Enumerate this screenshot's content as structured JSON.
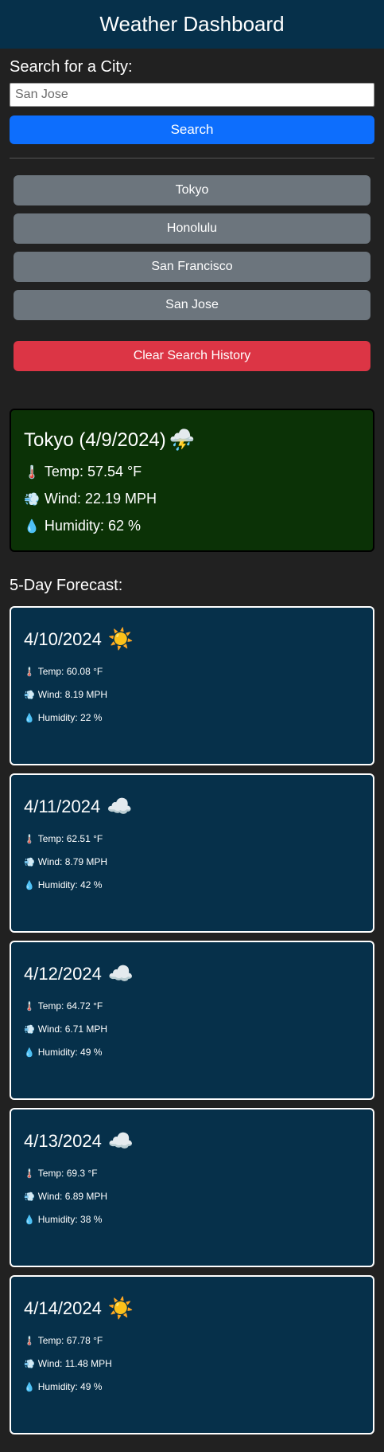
{
  "header": {
    "title": "Weather Dashboard"
  },
  "search": {
    "label": "Search for a City:",
    "value": "San Jose",
    "button_label": "Search"
  },
  "history": {
    "items": [
      {
        "label": "Tokyo"
      },
      {
        "label": "Honolulu"
      },
      {
        "label": "San Francisco"
      },
      {
        "label": "San Jose"
      }
    ],
    "clear_label": "Clear Search History"
  },
  "current": {
    "title": "Tokyo (4/9/2024)",
    "icon": "⛈️",
    "icon_name": "thunderstorm-sun-icon",
    "temp": "Temp: 57.54 °F",
    "wind": "Wind: 22.19 MPH",
    "humidity": "Humidity: 62 %"
  },
  "labels": {
    "temp_icon": "🌡️",
    "wind_icon": "💨",
    "humidity_icon": "💧"
  },
  "forecast": {
    "heading": "5-Day Forecast:",
    "days": [
      {
        "date": "4/10/2024",
        "icon": "☀️",
        "icon_name": "sun-icon",
        "temp": "Temp: 60.08 °F",
        "wind": "Wind: 8.19 MPH",
        "humidity": "Humidity: 22 %"
      },
      {
        "date": "4/11/2024",
        "icon": "☁️",
        "icon_name": "cloud-icon",
        "temp": "Temp: 62.51 °F",
        "wind": "Wind: 8.79 MPH",
        "humidity": "Humidity: 42 %"
      },
      {
        "date": "4/12/2024",
        "icon": "☁️",
        "icon_name": "cloud-icon",
        "temp": "Temp: 64.72 °F",
        "wind": "Wind: 6.71 MPH",
        "humidity": "Humidity: 49 %"
      },
      {
        "date": "4/13/2024",
        "icon": "☁️",
        "icon_name": "cloud-icon",
        "temp": "Temp: 69.3 °F",
        "wind": "Wind: 6.89 MPH",
        "humidity": "Humidity: 38 %"
      },
      {
        "date": "4/14/2024",
        "icon": "☀️",
        "icon_name": "sun-icon",
        "temp": "Temp: 67.78 °F",
        "wind": "Wind: 11.48 MPH",
        "humidity": "Humidity: 49 %"
      }
    ]
  },
  "colors": {
    "background": "#212121",
    "header": "#06304a",
    "search_button": "#0d6efd",
    "history_button": "#6c757d",
    "clear_button": "#dc3545",
    "current_card": "#0b3206",
    "forecast_card": "#06304a"
  }
}
